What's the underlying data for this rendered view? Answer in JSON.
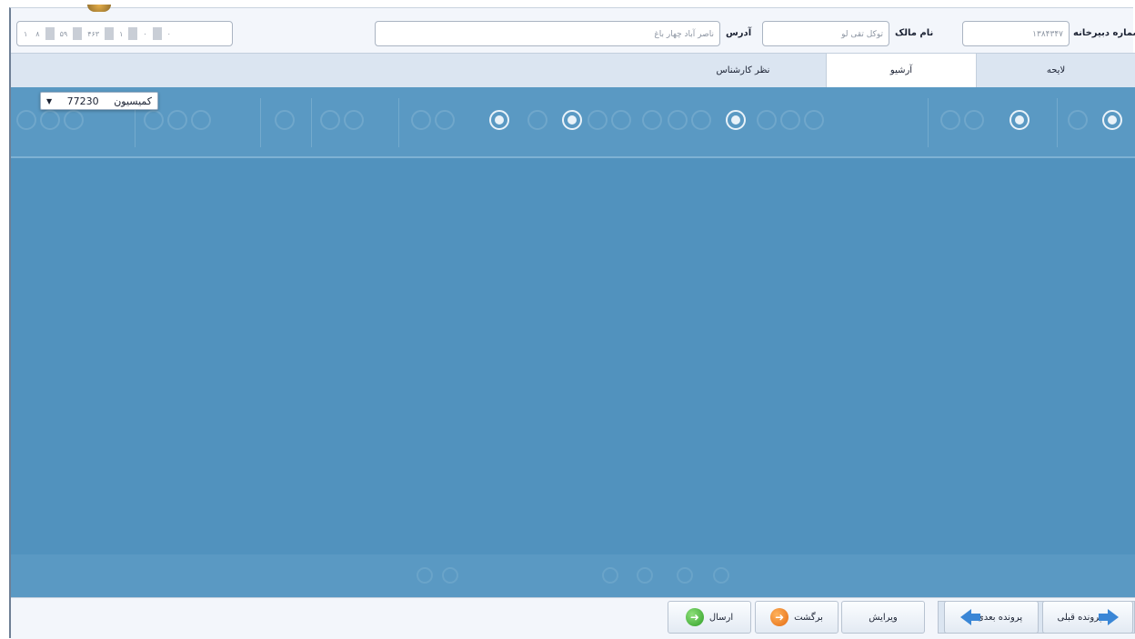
{
  "header": {
    "case_number_label": "شماره دبیرخانه",
    "case_number_value": "۱۳۸۴۳۴۷",
    "owner_label": "نام مالک",
    "owner_value": "توکل تقی لو",
    "address_label": "آدرس",
    "address_value": "ناصر آباد چهار باغ",
    "code_segments": [
      "۱",
      "۸",
      "۵۹",
      "۴۶۳",
      "۱",
      "۰",
      "۰"
    ]
  },
  "tabs": [
    {
      "label": "لایحه",
      "active": false
    },
    {
      "label": "آرشیو",
      "active": true
    },
    {
      "label": "نظر کارشناس",
      "active": false
    }
  ],
  "viewer": {
    "commission_label": "کمیسیون",
    "commission_value": "77230",
    "accent_color": "#5192be"
  },
  "footer": {
    "prev_case_label": "پرونده قبلی",
    "next_case_label": "پرونده بعدی",
    "edit_label": "ویرایش",
    "return_label": "برگشت",
    "send_label": "ارسال"
  }
}
